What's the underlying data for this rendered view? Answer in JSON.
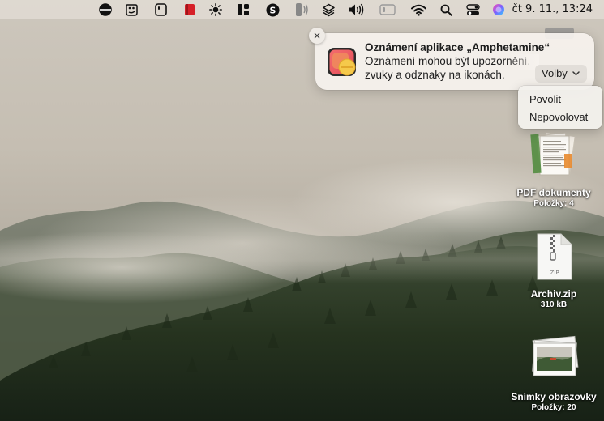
{
  "menubar": {
    "icons": [
      "circle-half-icon",
      "paint-palette-icon",
      "tablet-icon",
      "red-app-icon",
      "brightness-icon",
      "window-layout-icon",
      "dollar-sync-icon",
      "phone-icon",
      "layers-icon",
      "volume-icon",
      "display-icon",
      "wifi-icon",
      "search-icon",
      "control-center-icon",
      "siri-icon"
    ],
    "clock": "čt 9. 11., 13:24"
  },
  "notification": {
    "title": "Oznámení aplikace „Amphetamine“",
    "body": "Oznámení mohou být upozornění, zvuky a odznaky na ikonách.",
    "options_label": "Volby",
    "close_icon": "×",
    "app_icon": "amphetamine-pill-icon"
  },
  "options_menu": {
    "items": [
      "Povolit",
      "Nepovolovat"
    ]
  },
  "desktop": {
    "items": [
      {
        "label": "PDF dokumenty",
        "sub": "Položky: 4",
        "icon": "pdf-stack-icon"
      },
      {
        "label": "Archiv.zip",
        "sub": "310 kB",
        "icon": "zip-file-icon",
        "badge": "ZIP"
      },
      {
        "label": "Snímky obrazovky",
        "sub": "Položky: 20",
        "icon": "screenshots-stack-icon"
      }
    ]
  },
  "colors": {
    "accent_red": "#d62028",
    "pill_orange": "#f08a5d",
    "pill_yellow": "#f5c94b"
  }
}
